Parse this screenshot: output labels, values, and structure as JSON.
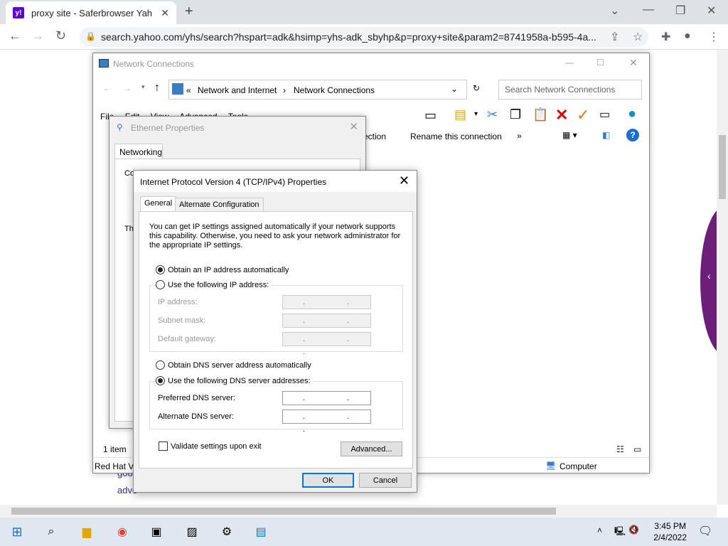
{
  "browser": {
    "tab_title": "proxy site - Saferbrowser Yahoo",
    "tab_favicon": "y!",
    "url": "search.yahoo.com/yhs/search?hspart=adk&hsimp=yhs-adk_sbyhp&p=proxy+site&param2=8741958a-b595-4a..."
  },
  "page": {
    "snippet1": "goo",
    "snippet2": "adve"
  },
  "netwin": {
    "title": "Network Connections",
    "breadcrumb_1": "Network and Internet",
    "breadcrumb_2": "Network Connections",
    "search_placeholder": "Search Network Connections",
    "menu": [
      "File",
      "Edit",
      "View",
      "Advanced",
      "Tools"
    ],
    "cmd_partial": "ection",
    "cmd_rename": "Rename this connection",
    "cmd_more": "»",
    "status_items": "1 item",
    "status_left": "Red Hat Vi",
    "status_computer": "Computer"
  },
  "ethwin": {
    "title": "Ethernet Properties",
    "tab": "Networking",
    "connect_label": "Connect using:",
    "this_label": "Th"
  },
  "ipdlg": {
    "title": "Internet Protocol Version 4 (TCP/IPv4) Properties",
    "tab_general": "General",
    "tab_alternate": "Alternate Configuration",
    "description": "You can get IP settings assigned automatically if your network supports this capability. Otherwise, you need to ask your network administrator for the appropriate IP settings.",
    "obtain_ip": "Obtain an IP address automatically",
    "use_ip": "Use the following IP address:",
    "ip_address": "IP address:",
    "subnet_mask": "Subnet mask:",
    "default_gateway": "Default gateway:",
    "ip_placeholder": ". . .",
    "obtain_dns": "Obtain DNS server address automatically",
    "use_dns": "Use the following DNS server addresses:",
    "preferred_dns": "Preferred DNS server:",
    "alternate_dns": "Alternate DNS server:",
    "validate": "Validate settings upon exit",
    "advanced": "Advanced...",
    "ok": "OK",
    "cancel": "Cancel"
  },
  "taskbar": {
    "time": "3:45 PM",
    "date": "2/4/2022"
  },
  "colors": {
    "accent": "#0078d7",
    "yahoo_purple": "#5f01d1",
    "page_purple": "#6b1e7a"
  }
}
